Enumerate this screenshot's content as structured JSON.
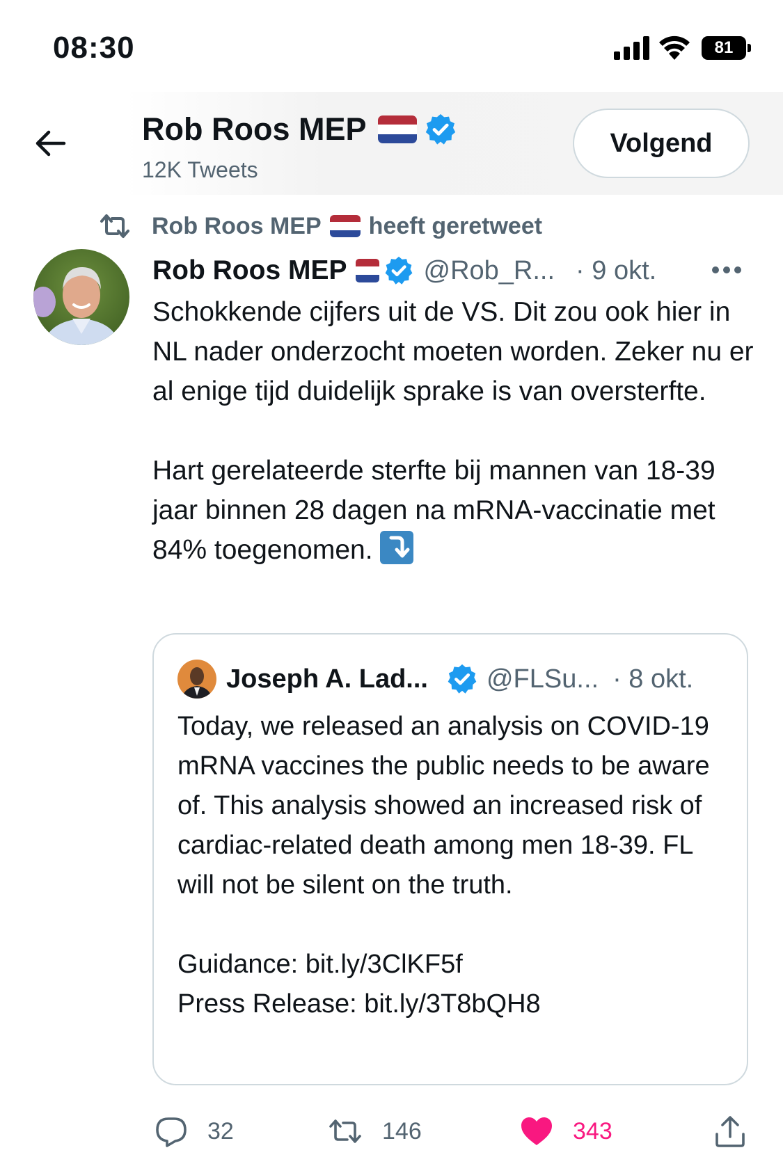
{
  "status_bar": {
    "time": "08:30",
    "battery": "81"
  },
  "header": {
    "name": "Rob Roos MEP",
    "tweet_count": "12K Tweets",
    "follow_button": "Volgend"
  },
  "retweet_line": {
    "name": "Rob Roos MEP",
    "suffix": "heeft geretweet"
  },
  "tweet": {
    "name": "Rob Roos MEP",
    "handle": "@Rob_R...",
    "date": "· 9 okt.",
    "text_part1": "Schokkende cijfers uit de VS. Dit zou ook hier in NL nader onderzocht moeten worden. Zeker nu er al enige tijd duidelijk sprake is van oversterfte.",
    "text_part2": "Hart gerelateerde sterfte bij mannen van 18-39 jaar binnen 28 dagen na mRNA-vaccinatie met 84% toegenomen. "
  },
  "quoted_tweet": {
    "name": "Joseph A. Lad...",
    "handle": "@FLSu...",
    "date": "· 8 okt.",
    "text": "Today, we released an analysis on COVID-19 mRNA vaccines the public needs to be aware of. This analysis showed an increased risk of cardiac-related death among men 18-39. FL will not be silent on the truth.",
    "guidance_label": "Guidance:",
    "guidance_link": "bit.ly/3ClKF5f",
    "press_label": "Press Release:",
    "press_link": "bit.ly/3T8bQH8"
  },
  "actions": {
    "replies": "32",
    "retweets": "146",
    "likes": "343"
  },
  "colors": {
    "accent_blue": "#1d9bf0",
    "like_pink": "#f91880",
    "muted_text": "#536471"
  },
  "icons": [
    "back-arrow-icon",
    "flag-nl-icon",
    "verified-badge-icon",
    "retweet-icon",
    "more-icon",
    "arrow-down-right-emoji",
    "reply-icon",
    "like-heart-icon",
    "share-icon",
    "signal-icon",
    "wifi-icon",
    "battery-icon"
  ]
}
